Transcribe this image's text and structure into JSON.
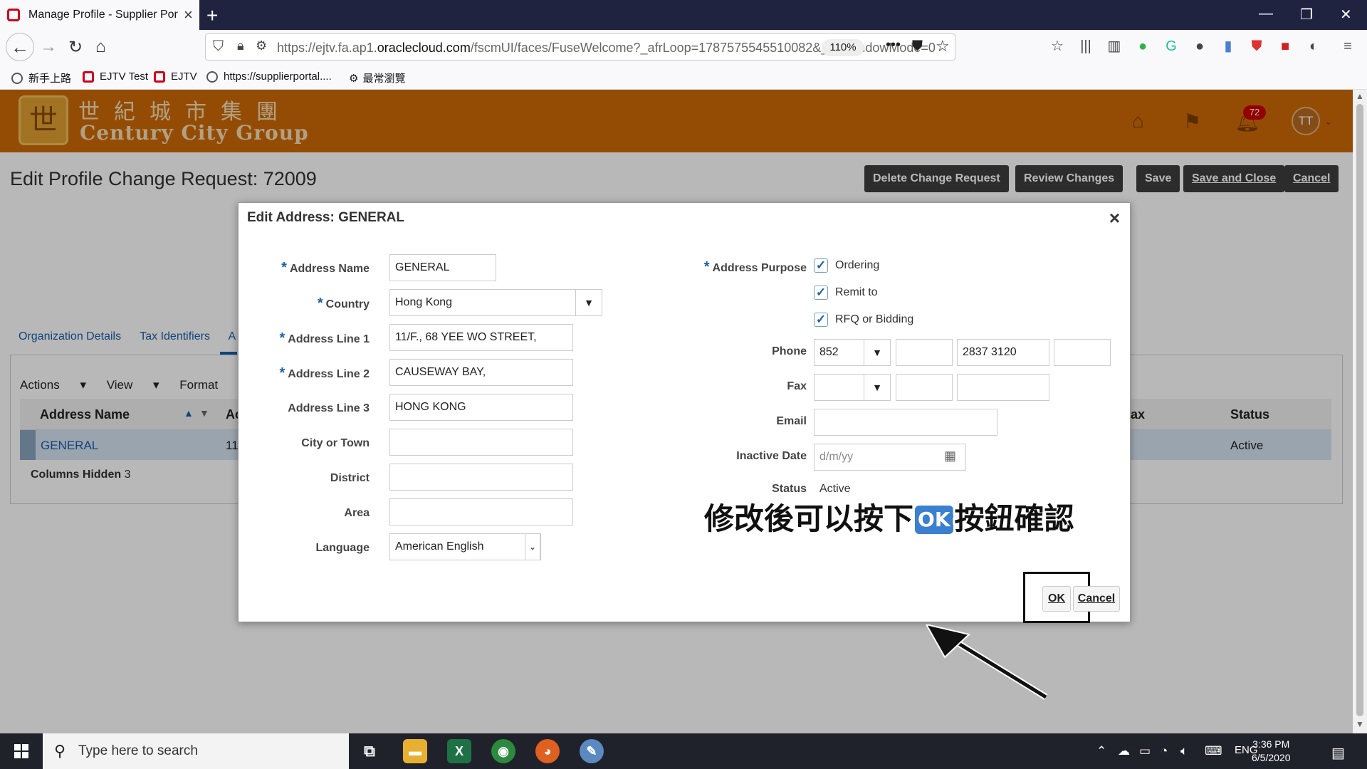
{
  "browser": {
    "tab_title": "Manage Profile - Supplier Portal",
    "url_prefix": "https://ejtv.fa.ap1.",
    "url_domain": "oraclecloud.com",
    "url_rest": "/fscmUI/faces/FuseWelcome?_afrLoop=1787575545510082&_afrWindowMode=0",
    "zoom": "110%",
    "bookmarks": [
      "新手上路",
      "EJTV Test",
      "EJTV",
      "https://supplierportal....",
      "最常瀏覽"
    ]
  },
  "brand": {
    "name_cn": "世紀城市集團",
    "name_en": "Century City Group",
    "notification_count": "72",
    "avatar_initials": "TT"
  },
  "page": {
    "title": "Edit Profile Change Request: 72009",
    "buttons": {
      "delete": "Delete Change Request",
      "review": "Review Changes",
      "save": "Save",
      "save_close": "Save and Close",
      "cancel": "Cancel"
    },
    "tabs": [
      "Organization Details",
      "Tax Identifiers",
      "A"
    ],
    "table_menu": {
      "actions": "Actions",
      "view": "View",
      "format": "Format"
    },
    "table": {
      "col_address_name": "Address Name",
      "col_ad": "Ac",
      "col_fax": "ax",
      "col_status": "Status",
      "row_name": "GENERAL",
      "row_partial": "11",
      "row_status": "Active",
      "columns_hidden_label": "Columns Hidden",
      "columns_hidden_count": "3"
    }
  },
  "dialog": {
    "title": "Edit Address: GENERAL",
    "labels": {
      "address_name": "Address Name",
      "country": "Country",
      "line1": "Address Line 1",
      "line2": "Address Line 2",
      "line3": "Address Line 3",
      "city": "City or Town",
      "district": "District",
      "area": "Area",
      "language": "Language",
      "purpose": "Address Purpose",
      "phone": "Phone",
      "fax": "Fax",
      "email": "Email",
      "inactive_date": "Inactive Date",
      "status": "Status"
    },
    "values": {
      "address_name": "GENERAL",
      "country": "Hong Kong",
      "line1": "11/F., 68 YEE WO STREET,",
      "line2": "CAUSEWAY BAY,",
      "line3": "HONG KONG",
      "city": "",
      "district": "",
      "area": "",
      "language": "American English",
      "phone_country": "852",
      "phone_area": "",
      "phone_number": "2837 3120",
      "phone_ext": "",
      "fax_country": "",
      "fax_area": "",
      "fax_number": "",
      "email": "",
      "inactive_date_placeholder": "d/m/yy",
      "status": "Active"
    },
    "purposes": [
      "Ordering",
      "Remit to",
      "RFQ or Bidding"
    ],
    "ok": "OK",
    "cancel": "Cancel"
  },
  "annotation": {
    "before": "修改後可以按下",
    "chip": "OK",
    "after": "按鈕確認"
  },
  "taskbar": {
    "search_placeholder": "Type here to search",
    "lang": "ENG",
    "time": "3:36 PM",
    "date": "6/5/2020"
  },
  "colors": {
    "brand_orange": "#cd6a08",
    "link_blue": "#1a5fa8",
    "button_dark": "#3d3d3d"
  }
}
